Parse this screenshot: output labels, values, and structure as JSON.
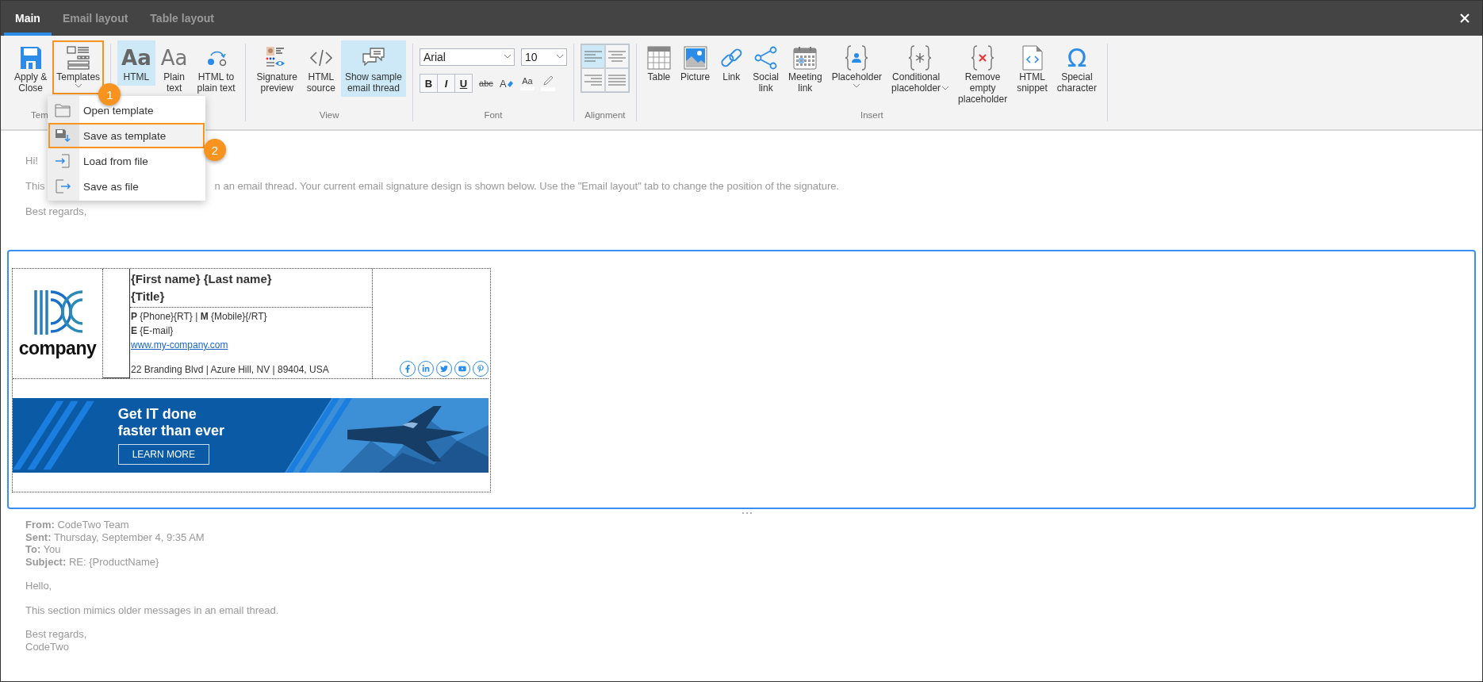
{
  "tabs": [
    {
      "label": "Main",
      "selected": true
    },
    {
      "label": "Email layout",
      "selected": false
    },
    {
      "label": "Table layout",
      "selected": false
    }
  ],
  "ribbon": {
    "groups": [
      {
        "kind": "buttons",
        "label": "Tem",
        "items": [
          {
            "label": "Apply &\nClose",
            "dropdown": false,
            "selected": false
          },
          {
            "label": "Templates",
            "dropdown": true,
            "selected": false,
            "callout": "1"
          }
        ]
      },
      {
        "kind": "buttons",
        "items": [
          {
            "label": "HTML",
            "glyph": "Aa",
            "dropdown": false,
            "selected": true
          },
          {
            "label": "Plain\ntext",
            "glyph": "Aa",
            "dropdown": false,
            "selected": false
          },
          {
            "label": "HTML to\nplain text",
            "dropdown": false,
            "selected": false
          }
        ]
      },
      {
        "kind": "buttons",
        "label": "View",
        "items": [
          {
            "label": "Signature\npreview",
            "dropdown": false,
            "selected": false
          },
          {
            "label": "HTML\nsource",
            "dropdown": false,
            "selected": false
          },
          {
            "label": "Show sample\nemail thread",
            "dropdown": false,
            "selected": true
          }
        ]
      },
      {
        "kind": "font",
        "label": "Font",
        "font": "Arial",
        "size": "10",
        "styles": [
          {
            "kind": "bold",
            "glyph": "B"
          },
          {
            "kind": "italic",
            "glyph": "I"
          },
          {
            "kind": "underline",
            "glyph": "U"
          },
          {
            "kind": "strike",
            "glyph": "abc"
          },
          {
            "kind": "clear",
            "glyph": "A"
          },
          {
            "kind": "case",
            "glyph": "Aa"
          },
          {
            "kind": "highlight"
          }
        ]
      },
      {
        "kind": "alignment",
        "label": "Alignment",
        "items": [
          {
            "selected": true
          },
          {
            "selected": false
          },
          {
            "selected": false
          },
          {
            "selected": false
          }
        ]
      },
      {
        "kind": "buttons",
        "label": "Insert",
        "items": [
          {
            "label": "Table",
            "dropdown": false,
            "selected": false
          },
          {
            "label": "Picture",
            "dropdown": false,
            "selected": false
          },
          {
            "label": "Link",
            "dropdown": false,
            "selected": false
          },
          {
            "label": "Social\nlink",
            "dropdown": false,
            "selected": false
          },
          {
            "label": "Meeting\nlink",
            "dropdown": false,
            "selected": false
          },
          {
            "label": "Placeholder",
            "dropdown": true,
            "selected": false
          },
          {
            "label": "Conditional\nplaceholder",
            "dropdown": true,
            "selected": false
          },
          {
            "label": "Remove\nempty\nplaceholder",
            "dropdown": false,
            "selected": false
          },
          {
            "label": "HTML\nsnippet",
            "dropdown": false,
            "selected": false
          },
          {
            "label": "Special\ncharacter",
            "glyph": "Ω",
            "dropdown": false,
            "selected": false
          }
        ]
      }
    ]
  },
  "templates_menu": {
    "items": [
      {
        "label": "Open template",
        "selected": false
      },
      {
        "label": "Save as template",
        "selected": true,
        "callout": "2"
      },
      {
        "label": "Load from file",
        "selected": false
      },
      {
        "label": "Save as file",
        "selected": false
      }
    ]
  },
  "intro": {
    "greeting": "Hi!",
    "line_start": "This",
    "line_rest": "n an email thread. Your current email signature design is shown below. Use the \"Email layout\" tab to change the position of the signature.",
    "closing": "Best regards,"
  },
  "signature": {
    "logo_text": "company",
    "name": "{First name} {Last name}",
    "title": "{Title}",
    "contacts": [
      "**P** {Phone}{RT} | **M** {Mobile}{/RT}",
      "**E** {E-mail}"
    ],
    "website": "www.my-company.com",
    "address": "22 Branding Blvd | Azure Hill, NV | 89404, USA",
    "banner": {
      "headline": [
        "Get IT done",
        "faster than ever"
      ],
      "button": "LEARN MORE"
    }
  },
  "quoted": {
    "headers": [
      "**From:** CodeTwo Team",
      "**Sent:** Thursday, September 4, 9:35 AM",
      "**To:** You",
      "**Subject:** RE: {ProductName}"
    ],
    "greeting": "Hello,",
    "body": "This section mimics older messages in an email thread.",
    "closing": "Best regards,",
    "sender": "CodeTwo"
  }
}
